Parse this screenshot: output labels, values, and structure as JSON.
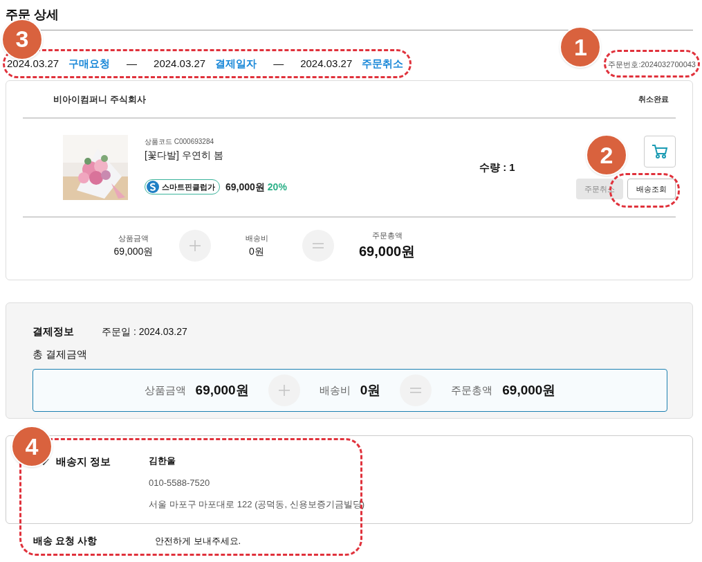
{
  "page_title": "주문 상세",
  "timeline": [
    {
      "date": "2024.03.27",
      "label": "구매요청"
    },
    {
      "date": "2024.03.27",
      "label": "결제일자"
    },
    {
      "date": "2024.03.27",
      "label": "주문취소"
    }
  ],
  "timeline_separator": "—",
  "order_number": "주문번호:2024032700043",
  "seller": {
    "name": "비아이컴퍼니 주식회사",
    "status": "취소완료"
  },
  "product": {
    "code": "상품코드 C000693284",
    "name": "[꽃다발] 우연히 봄",
    "club_badge": "스마트핀클럽가",
    "price": "69,000원",
    "discount": "20%",
    "quantity": "수량 : 1"
  },
  "actions": [
    {
      "label": "주문취소",
      "disabled": true
    },
    {
      "label": "배송조회",
      "disabled": false
    }
  ],
  "summary": {
    "items": [
      {
        "label": "상품금액",
        "value": "69,000원"
      },
      {
        "label": "배송비",
        "value": "0원"
      },
      {
        "label": "주문총액",
        "value": "69,000원"
      }
    ]
  },
  "payment": {
    "title": "결제정보",
    "order_date": "주문일 : 2024.03.27",
    "total_title": "총 결제금액",
    "items": [
      {
        "label": "상품금액",
        "value": "69,000원"
      },
      {
        "label": "배송비",
        "value": "0원"
      },
      {
        "label": "주문총액",
        "value": "69,000원"
      }
    ]
  },
  "shipping": {
    "title": "배송지 정보",
    "name": "김한울",
    "phone": "010-5588-7520",
    "address": "서울 마포구 마포대로 122 (공덕동, 신용보증기금빌딩)",
    "request_label": "배송 요청 사항",
    "request": "안전하게 보내주세요."
  },
  "annotations": [
    {
      "number": "1"
    },
    {
      "number": "2"
    },
    {
      "number": "3"
    },
    {
      "number": "4"
    }
  ]
}
